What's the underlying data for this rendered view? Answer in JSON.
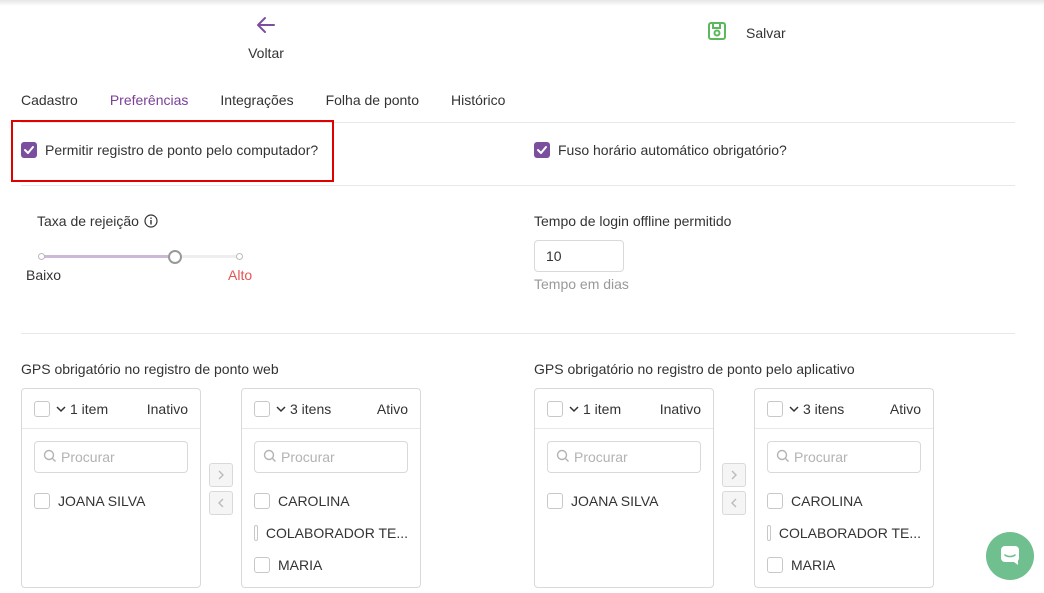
{
  "header": {
    "back_label": "Voltar",
    "save_label": "Salvar"
  },
  "tabs": [
    {
      "label": "Cadastro",
      "active": false
    },
    {
      "label": "Preferências",
      "active": true
    },
    {
      "label": "Integrações",
      "active": false
    },
    {
      "label": "Folha de ponto",
      "active": false
    },
    {
      "label": "Histórico",
      "active": false
    }
  ],
  "options": {
    "allow_computer": {
      "label": "Permitir registro de ponto pelo computador?",
      "checked": true
    },
    "auto_timezone": {
      "label": "Fuso horário automático obrigatório?",
      "checked": true
    }
  },
  "rejection": {
    "label": "Taxa de rejeição",
    "low_label": "Baixo",
    "high_label": "Alto",
    "level_fraction": 0.67
  },
  "offline": {
    "label": "Tempo de login offline permitido",
    "value": "10",
    "hint": "Tempo em dias"
  },
  "gps_web": {
    "title": "GPS obrigatório no registro de ponto web",
    "left": {
      "count": "1 item",
      "status": "Inativo",
      "search_placeholder": "Procurar",
      "items": [
        "JOANA SILVA"
      ]
    },
    "right": {
      "count": "3 itens",
      "status": "Ativo",
      "search_placeholder": "Procurar",
      "items": [
        "CAROLINA",
        "COLABORADOR TE...",
        "MARIA"
      ]
    }
  },
  "gps_app": {
    "title": "GPS obrigatório no registro de ponto pelo aplicativo",
    "left": {
      "count": "1 item",
      "status": "Inativo",
      "search_placeholder": "Procurar",
      "items": [
        "JOANA SILVA"
      ]
    },
    "right": {
      "count": "3 itens",
      "status": "Ativo",
      "search_placeholder": "Procurar",
      "items": [
        "CAROLINA",
        "COLABORADOR TE...",
        "MARIA"
      ]
    }
  },
  "colors": {
    "accent": "#7b4f9e",
    "alert_red": "#e55353",
    "highlight_border": "#e00000",
    "chat_green": "#6fbf8f"
  },
  "icons": [
    "arrow-left-icon",
    "save-icon",
    "info-icon",
    "chevron-down-icon",
    "search-icon",
    "chevron-right-icon",
    "chevron-left-icon",
    "chat-icon"
  ]
}
